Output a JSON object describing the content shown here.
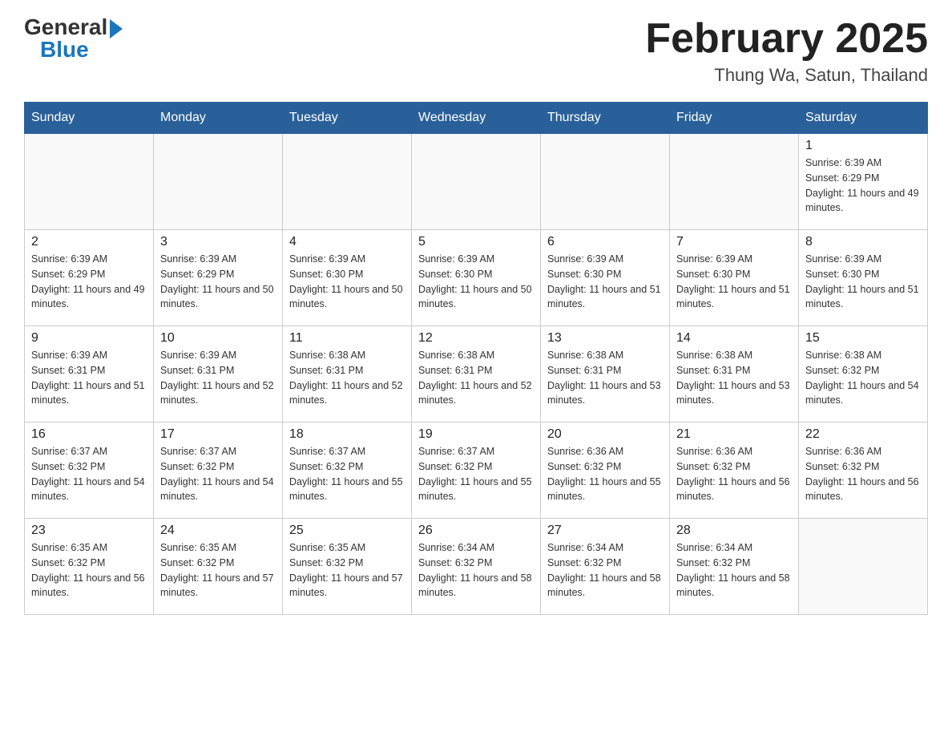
{
  "header": {
    "logo_general": "General",
    "logo_blue": "Blue",
    "month_title": "February 2025",
    "location": "Thung Wa, Satun, Thailand"
  },
  "days_of_week": [
    "Sunday",
    "Monday",
    "Tuesday",
    "Wednesday",
    "Thursday",
    "Friday",
    "Saturday"
  ],
  "weeks": [
    [
      {
        "day": "",
        "info": ""
      },
      {
        "day": "",
        "info": ""
      },
      {
        "day": "",
        "info": ""
      },
      {
        "day": "",
        "info": ""
      },
      {
        "day": "",
        "info": ""
      },
      {
        "day": "",
        "info": ""
      },
      {
        "day": "1",
        "info": "Sunrise: 6:39 AM\nSunset: 6:29 PM\nDaylight: 11 hours and 49 minutes."
      }
    ],
    [
      {
        "day": "2",
        "info": "Sunrise: 6:39 AM\nSunset: 6:29 PM\nDaylight: 11 hours and 49 minutes."
      },
      {
        "day": "3",
        "info": "Sunrise: 6:39 AM\nSunset: 6:29 PM\nDaylight: 11 hours and 50 minutes."
      },
      {
        "day": "4",
        "info": "Sunrise: 6:39 AM\nSunset: 6:30 PM\nDaylight: 11 hours and 50 minutes."
      },
      {
        "day": "5",
        "info": "Sunrise: 6:39 AM\nSunset: 6:30 PM\nDaylight: 11 hours and 50 minutes."
      },
      {
        "day": "6",
        "info": "Sunrise: 6:39 AM\nSunset: 6:30 PM\nDaylight: 11 hours and 51 minutes."
      },
      {
        "day": "7",
        "info": "Sunrise: 6:39 AM\nSunset: 6:30 PM\nDaylight: 11 hours and 51 minutes."
      },
      {
        "day": "8",
        "info": "Sunrise: 6:39 AM\nSunset: 6:30 PM\nDaylight: 11 hours and 51 minutes."
      }
    ],
    [
      {
        "day": "9",
        "info": "Sunrise: 6:39 AM\nSunset: 6:31 PM\nDaylight: 11 hours and 51 minutes."
      },
      {
        "day": "10",
        "info": "Sunrise: 6:39 AM\nSunset: 6:31 PM\nDaylight: 11 hours and 52 minutes."
      },
      {
        "day": "11",
        "info": "Sunrise: 6:38 AM\nSunset: 6:31 PM\nDaylight: 11 hours and 52 minutes."
      },
      {
        "day": "12",
        "info": "Sunrise: 6:38 AM\nSunset: 6:31 PM\nDaylight: 11 hours and 52 minutes."
      },
      {
        "day": "13",
        "info": "Sunrise: 6:38 AM\nSunset: 6:31 PM\nDaylight: 11 hours and 53 minutes."
      },
      {
        "day": "14",
        "info": "Sunrise: 6:38 AM\nSunset: 6:31 PM\nDaylight: 11 hours and 53 minutes."
      },
      {
        "day": "15",
        "info": "Sunrise: 6:38 AM\nSunset: 6:32 PM\nDaylight: 11 hours and 54 minutes."
      }
    ],
    [
      {
        "day": "16",
        "info": "Sunrise: 6:37 AM\nSunset: 6:32 PM\nDaylight: 11 hours and 54 minutes."
      },
      {
        "day": "17",
        "info": "Sunrise: 6:37 AM\nSunset: 6:32 PM\nDaylight: 11 hours and 54 minutes."
      },
      {
        "day": "18",
        "info": "Sunrise: 6:37 AM\nSunset: 6:32 PM\nDaylight: 11 hours and 55 minutes."
      },
      {
        "day": "19",
        "info": "Sunrise: 6:37 AM\nSunset: 6:32 PM\nDaylight: 11 hours and 55 minutes."
      },
      {
        "day": "20",
        "info": "Sunrise: 6:36 AM\nSunset: 6:32 PM\nDaylight: 11 hours and 55 minutes."
      },
      {
        "day": "21",
        "info": "Sunrise: 6:36 AM\nSunset: 6:32 PM\nDaylight: 11 hours and 56 minutes."
      },
      {
        "day": "22",
        "info": "Sunrise: 6:36 AM\nSunset: 6:32 PM\nDaylight: 11 hours and 56 minutes."
      }
    ],
    [
      {
        "day": "23",
        "info": "Sunrise: 6:35 AM\nSunset: 6:32 PM\nDaylight: 11 hours and 56 minutes."
      },
      {
        "day": "24",
        "info": "Sunrise: 6:35 AM\nSunset: 6:32 PM\nDaylight: 11 hours and 57 minutes."
      },
      {
        "day": "25",
        "info": "Sunrise: 6:35 AM\nSunset: 6:32 PM\nDaylight: 11 hours and 57 minutes."
      },
      {
        "day": "26",
        "info": "Sunrise: 6:34 AM\nSunset: 6:32 PM\nDaylight: 11 hours and 58 minutes."
      },
      {
        "day": "27",
        "info": "Sunrise: 6:34 AM\nSunset: 6:32 PM\nDaylight: 11 hours and 58 minutes."
      },
      {
        "day": "28",
        "info": "Sunrise: 6:34 AM\nSunset: 6:32 PM\nDaylight: 11 hours and 58 minutes."
      },
      {
        "day": "",
        "info": ""
      }
    ]
  ]
}
